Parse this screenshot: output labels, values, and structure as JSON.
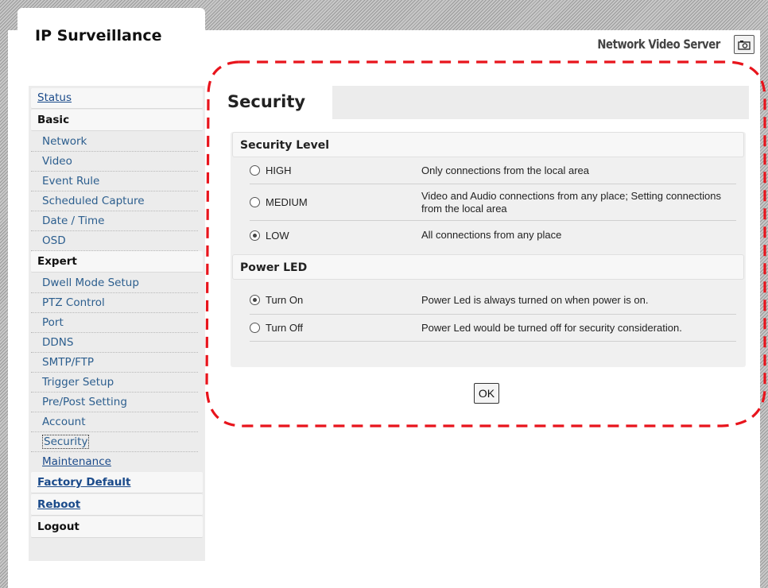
{
  "header": {
    "brand": "IP Surveillance",
    "product": "Network Video Server",
    "camera_icon": "camera-icon"
  },
  "sidebar": {
    "status": "Status",
    "basic": {
      "title": "Basic",
      "items": [
        "Network",
        "Video",
        "Event Rule",
        "Scheduled Capture",
        "Date / Time",
        "OSD"
      ]
    },
    "expert": {
      "title": "Expert",
      "items": [
        "Dwell Mode Setup",
        "PTZ Control",
        "Port",
        "DDNS",
        "SMTP/FTP",
        "Trigger Setup",
        "Pre/Post Setting",
        "Account",
        "Security",
        "Maintenance"
      ],
      "selected": "Security"
    },
    "factory_default": "Factory Default",
    "reboot": "Reboot",
    "logout": "Logout"
  },
  "main": {
    "title": "Security",
    "security_level": {
      "title": "Security Level",
      "options": [
        {
          "label": "HIGH",
          "desc": "Only connections from the local area",
          "checked": false
        },
        {
          "label": "MEDIUM",
          "desc": "Video and Audio connections from any place; Setting connections from the local area",
          "checked": false
        },
        {
          "label": "LOW",
          "desc": "All connections from any place",
          "checked": true
        }
      ]
    },
    "power_led": {
      "title": "Power LED",
      "options": [
        {
          "label": "Turn On",
          "desc": "Power Led is always turned on when power is on.",
          "checked": true
        },
        {
          "label": "Turn Off",
          "desc": "Power Led would be turned off for security consideration.",
          "checked": false
        }
      ]
    },
    "ok_label": "OK"
  },
  "colors": {
    "annotation": "#e8141c",
    "link": "#1a4a8a"
  }
}
